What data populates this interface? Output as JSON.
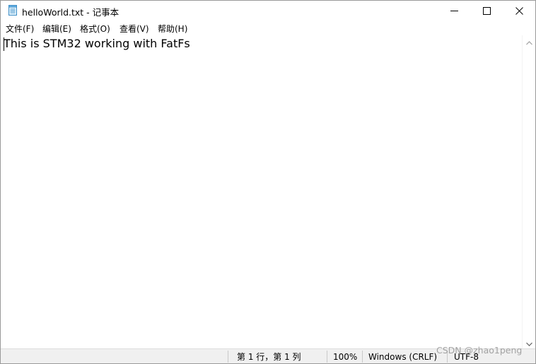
{
  "window": {
    "title": "helloWorld.txt - 记事本",
    "icon": "notepad-icon",
    "controls": {
      "minimize_icon": "minimize-icon",
      "maximize_icon": "maximize-icon",
      "close_icon": "close-icon"
    }
  },
  "menu": {
    "items": [
      {
        "label": "文件(F)"
      },
      {
        "label": "编辑(E)"
      },
      {
        "label": "格式(O)"
      },
      {
        "label": "查看(V)"
      },
      {
        "label": "帮助(H)"
      }
    ]
  },
  "editor": {
    "content": "This is STM32 working with FatFs"
  },
  "statusbar": {
    "position": "第 1 行，第 1 列",
    "zoom": "100%",
    "line_ending": "Windows (CRLF)",
    "encoding": "UTF-8"
  },
  "watermark": "CSDN @zhao1peng"
}
